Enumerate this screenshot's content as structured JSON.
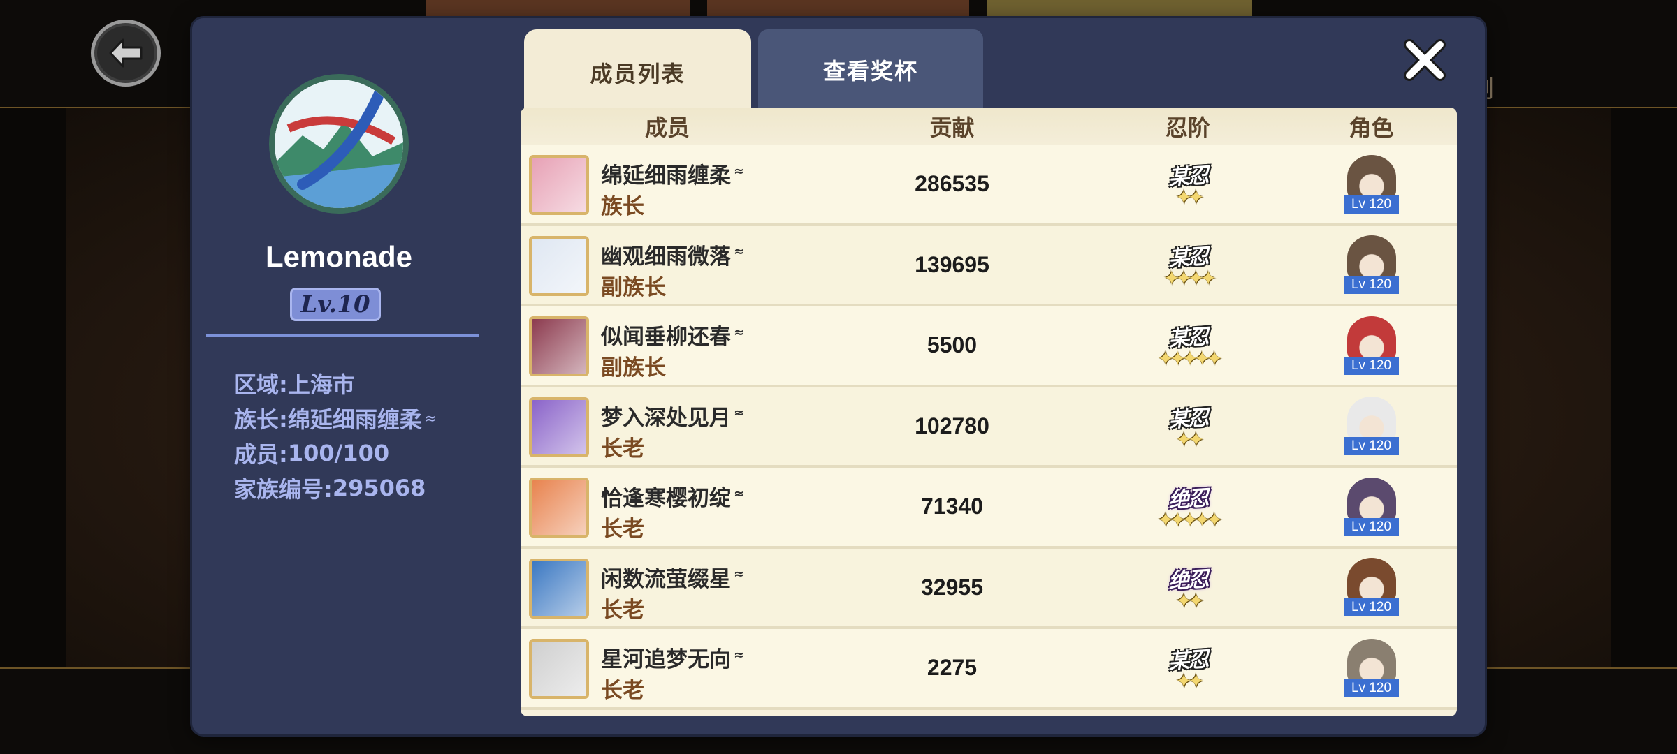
{
  "background": {
    "peek_text": "刎"
  },
  "panel": {
    "clan": {
      "name": "Lemonade",
      "level": "Lv.10",
      "info": [
        {
          "label": "区域",
          "value": "上海市"
        },
        {
          "label": "族长",
          "value": "绵延细雨缠柔",
          "mark": "⁓"
        },
        {
          "label": "成员",
          "value": "100/100"
        },
        {
          "label": "家族编号",
          "value": "295068"
        }
      ]
    },
    "tabs": {
      "members": "成员列表",
      "trophies": "查看奖杯"
    },
    "table": {
      "headers": {
        "member": "成员",
        "contribution": "贡献",
        "rank": "忍阶",
        "role": "角色"
      },
      "rows": [
        {
          "name": "绵延细雨缠柔",
          "title": "族长",
          "contribution": "286535",
          "rank": "某忍",
          "rank_style": "normal",
          "stars": "✦✦",
          "lv": "Lv 120",
          "avatar_color": "#e7a1b5",
          "portrait_color": "#6a5442"
        },
        {
          "name": "幽观细雨微落",
          "title": "副族长",
          "contribution": "139695",
          "rank": "某忍",
          "rank_style": "normal",
          "stars": "✦✦✦✦",
          "lv": "Lv 120",
          "avatar_color": "#dfe7f2",
          "portrait_color": "#6a5442"
        },
        {
          "name": "似闻垂柳还春",
          "title": "副族长",
          "contribution": "5500",
          "rank": "某忍",
          "rank_style": "normal",
          "stars": "✦✦✦✦✦",
          "lv": "Lv 120",
          "avatar_color": "#8c3a4e",
          "portrait_color": "#c23a3a"
        },
        {
          "name": "梦入深处见月",
          "title": "长老",
          "contribution": "102780",
          "rank": "某忍",
          "rank_style": "normal",
          "stars": "✦✦",
          "lv": "Lv 120",
          "avatar_color": "#8a63c9",
          "portrait_color": "#e9e9e9"
        },
        {
          "name": "恰逢寒樱初绽",
          "title": "长老",
          "contribution": "71340",
          "rank": "绝忍",
          "rank_style": "jue",
          "stars": "✦✦✦✦✦",
          "lv": "Lv 120",
          "avatar_color": "#e8834e",
          "portrait_color": "#5b4a6e"
        },
        {
          "name": "闲数流萤缀星",
          "title": "长老",
          "contribution": "32955",
          "rank": "绝忍",
          "rank_style": "jue",
          "stars": "✦✦",
          "lv": "Lv 120",
          "avatar_color": "#3b78c2",
          "portrait_color": "#7a4a2e"
        },
        {
          "name": "星河追梦无向",
          "title": "长老",
          "contribution": "2275",
          "rank": "某忍",
          "rank_style": "normal",
          "stars": "✦✦",
          "lv": "Lv 120",
          "avatar_color": "#cfcfcf",
          "portrait_color": "#8a7f70"
        }
      ]
    }
  }
}
